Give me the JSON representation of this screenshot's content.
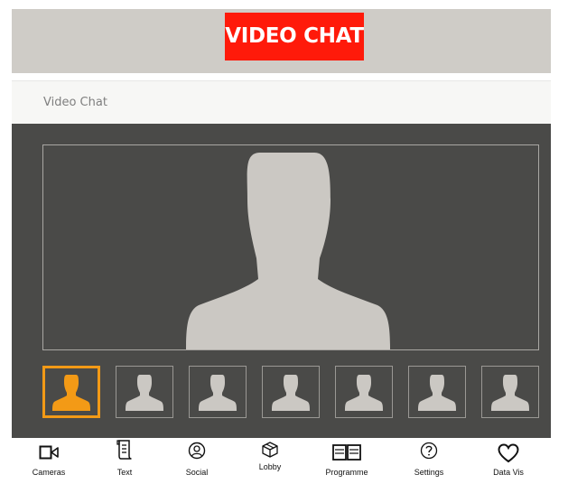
{
  "header": {
    "title": "VIDEO CHAT",
    "title_color": "#ff1a0a",
    "banner_color": "#cfccc7"
  },
  "subheader": {
    "text": "Video Chat"
  },
  "stage": {
    "background": "#4a4a48",
    "main_video_icon": "user-silhouette-icon",
    "thumbnail_count": 7,
    "active_thumbnail": 0,
    "active_color": "#f39a16"
  },
  "nav": {
    "items": [
      {
        "label": "Cameras",
        "icon": "video-camera-icon"
      },
      {
        "label": "Text",
        "icon": "scroll-icon"
      },
      {
        "label": "Social",
        "icon": "user-circle-icon"
      },
      {
        "label": "Lobby",
        "icon": "box-icon"
      },
      {
        "label": "Programme",
        "icon": "book-icon"
      },
      {
        "label": "Settings",
        "icon": "question-circle-icon"
      },
      {
        "label": "Data Vis",
        "icon": "heart-icon"
      }
    ]
  }
}
